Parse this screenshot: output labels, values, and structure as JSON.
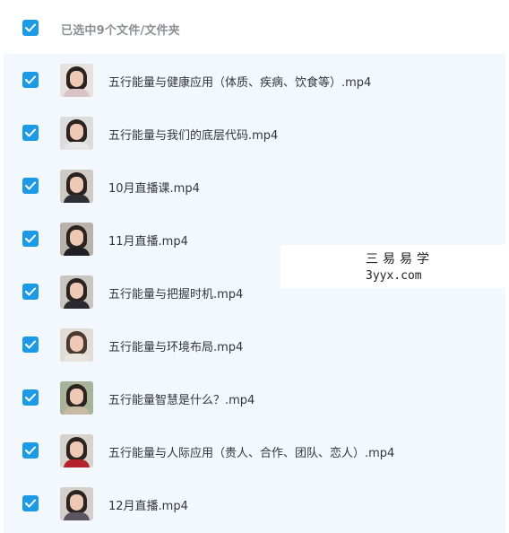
{
  "header": {
    "selection_label": "已选中9个文件/文件夹",
    "select_all_checked": true
  },
  "files": [
    {
      "name": "五行能量与健康应用（体质、疾病、饮食等）.mp4",
      "checked": true
    },
    {
      "name": "五行能量与我们的底层代码.mp4",
      "checked": true
    },
    {
      "name": "10月直播课.mp4",
      "checked": true
    },
    {
      "name": "11月直播.mp4",
      "checked": true
    },
    {
      "name": "五行能量与把握时机.mp4",
      "checked": true
    },
    {
      "name": "五行能量与环境布局.mp4",
      "checked": true
    },
    {
      "name": "五行能量智慧是什么？.mp4",
      "checked": true
    },
    {
      "name": "五行能量与人际应用（贵人、合作、团队、恋人）.mp4",
      "checked": true
    },
    {
      "name": "12月直播.mp4",
      "checked": true
    }
  ],
  "watermark": {
    "brand": "三易易学",
    "site": "3yyx.com"
  },
  "colors": {
    "accent": "#1c9ae6",
    "list_background": "#f2f8fe",
    "header_text": "#8c8f96",
    "file_text": "#33363b"
  }
}
